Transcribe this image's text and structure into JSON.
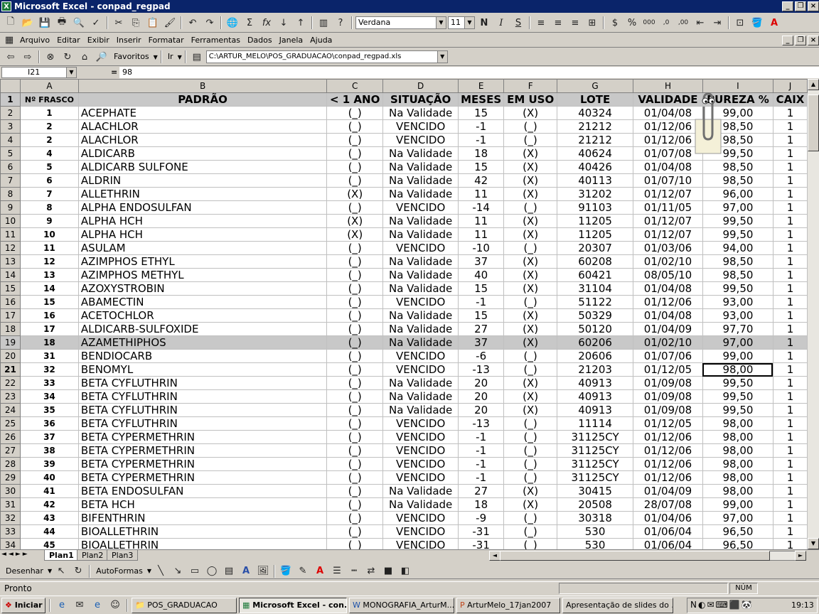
{
  "window": {
    "title": "Microsoft Excel - conpad_regpad"
  },
  "toolbar": {
    "font_name": "Verdana",
    "font_size": "11",
    "bold": "N",
    "italic": "I",
    "underline": "S"
  },
  "menu": [
    "Arquivo",
    "Editar",
    "Exibir",
    "Inserir",
    "Formatar",
    "Ferramentas",
    "Dados",
    "Janela",
    "Ajuda"
  ],
  "webbar": {
    "favorites": "Favoritos",
    "go": "Ir",
    "path": "C:\\ARTUR_MELO\\POS_GRADUACAO\\conpad_regpad.xls"
  },
  "formula_bar": {
    "name_box": "I21",
    "equals": "=",
    "value": "98"
  },
  "columns": [
    "A",
    "B",
    "C",
    "D",
    "E",
    "F",
    "G",
    "H",
    "I",
    "J"
  ],
  "headers": [
    "Nº FRASCO",
    "PADRÃO",
    "< 1 ANO",
    "SITUAÇÃO",
    "MESES",
    "EM USO",
    "LOTE",
    "VALIDADE",
    "PUREZA %",
    "CAIX"
  ],
  "rows": [
    [
      "2",
      "1",
      "ACEPHATE",
      "(_)",
      "Na Validade",
      "15",
      "(X)",
      "40324",
      "01/04/08",
      "99,00",
      "1"
    ],
    [
      "3",
      "2",
      "ALACHLOR",
      "(_)",
      "VENCIDO",
      "-1",
      "(_)",
      "21212",
      "01/12/06",
      "98,50",
      "1"
    ],
    [
      "4",
      "2",
      "ALACHLOR",
      "(_)",
      "VENCIDO",
      "-1",
      "(_)",
      "21212",
      "01/12/06",
      "98,50",
      "1"
    ],
    [
      "5",
      "4",
      "ALDICARB",
      "(_)",
      "Na Validade",
      "18",
      "(X)",
      "40624",
      "01/07/08",
      "99,50",
      "1"
    ],
    [
      "6",
      "5",
      "ALDICARB SULFONE",
      "(_)",
      "Na Validade",
      "15",
      "(X)",
      "40426",
      "01/04/08",
      "98,50",
      "1"
    ],
    [
      "7",
      "6",
      "ALDRIN",
      "(_)",
      "Na Validade",
      "42",
      "(X)",
      "40113",
      "01/07/10",
      "98,50",
      "1"
    ],
    [
      "8",
      "7",
      "ALLETHRIN",
      "(X)",
      "Na Validade",
      "11",
      "(X)",
      "31202",
      "01/12/07",
      "96,00",
      "1"
    ],
    [
      "9",
      "8",
      "ALPHA ENDOSULFAN",
      "(_)",
      "VENCIDO",
      "-14",
      "(_)",
      "91103",
      "01/11/05",
      "97,00",
      "1"
    ],
    [
      "10",
      "9",
      "ALPHA HCH",
      "(X)",
      "Na Validade",
      "11",
      "(X)",
      "11205",
      "01/12/07",
      "99,50",
      "1"
    ],
    [
      "11",
      "10",
      "ALPHA HCH",
      "(X)",
      "Na Validade",
      "11",
      "(X)",
      "11205",
      "01/12/07",
      "99,50",
      "1"
    ],
    [
      "12",
      "11",
      "ASULAM",
      "(_)",
      "VENCIDO",
      "-10",
      "(_)",
      "20307",
      "01/03/06",
      "94,00",
      "1"
    ],
    [
      "13",
      "12",
      "AZIMPHOS ETHYL",
      "(_)",
      "Na Validade",
      "37",
      "(X)",
      "60208",
      "01/02/10",
      "98,50",
      "1"
    ],
    [
      "14",
      "13",
      "AZIMPHOS METHYL",
      "(_)",
      "Na Validade",
      "40",
      "(X)",
      "60421",
      "08/05/10",
      "98,50",
      "1"
    ],
    [
      "15",
      "14",
      "AZOXYSTROBIN",
      "(_)",
      "Na Validade",
      "15",
      "(X)",
      "31104",
      "01/04/08",
      "99,50",
      "1"
    ],
    [
      "16",
      "15",
      "ABAMECTIN",
      "(_)",
      "VENCIDO",
      "-1",
      "(_)",
      "51122",
      "01/12/06",
      "93,00",
      "1"
    ],
    [
      "17",
      "16",
      "ACETOCHLOR",
      "(_)",
      "Na Validade",
      "15",
      "(X)",
      "50329",
      "01/04/08",
      "93,00",
      "1"
    ],
    [
      "18",
      "17",
      "ALDICARB-SULFOXIDE",
      "(_)",
      "Na Validade",
      "27",
      "(X)",
      "50120",
      "01/04/09",
      "97,70",
      "1"
    ],
    [
      "19",
      "18",
      "AZAMETHIPHOS",
      "(_)",
      "Na Validade",
      "37",
      "(X)",
      "60206",
      "01/02/10",
      "97,00",
      "1"
    ],
    [
      "20",
      "31",
      "BENDIOCARB",
      "(_)",
      "VENCIDO",
      "-6",
      "(_)",
      "20606",
      "01/07/06",
      "99,00",
      "1"
    ],
    [
      "21",
      "32",
      "BENOMYL",
      "(_)",
      "VENCIDO",
      "-13",
      "(_)",
      "21203",
      "01/12/05",
      "98,00",
      "1"
    ],
    [
      "22",
      "33",
      "BETA CYFLUTHRIN",
      "(_)",
      "Na Validade",
      "20",
      "(X)",
      "40913",
      "01/09/08",
      "99,50",
      "1"
    ],
    [
      "23",
      "34",
      "BETA CYFLUTHRIN",
      "(_)",
      "Na Validade",
      "20",
      "(X)",
      "40913",
      "01/09/08",
      "99,50",
      "1"
    ],
    [
      "24",
      "35",
      "BETA CYFLUTHRIN",
      "(_)",
      "Na Validade",
      "20",
      "(X)",
      "40913",
      "01/09/08",
      "99,50",
      "1"
    ],
    [
      "25",
      "36",
      "BETA CYFLUTHRIN",
      "(_)",
      "VENCIDO",
      "-13",
      "(_)",
      "11114",
      "01/12/05",
      "98,00",
      "1"
    ],
    [
      "26",
      "37",
      "BETA CYPERMETHRIN",
      "(_)",
      "VENCIDO",
      "-1",
      "(_)",
      "31125CY",
      "01/12/06",
      "98,00",
      "1"
    ],
    [
      "27",
      "38",
      "BETA CYPERMETHRIN",
      "(_)",
      "VENCIDO",
      "-1",
      "(_)",
      "31125CY",
      "01/12/06",
      "98,00",
      "1"
    ],
    [
      "28",
      "39",
      "BETA CYPERMETHRIN",
      "(_)",
      "VENCIDO",
      "-1",
      "(_)",
      "31125CY",
      "01/12/06",
      "98,00",
      "1"
    ],
    [
      "29",
      "40",
      "BETA CYPERMETHRIN",
      "(_)",
      "VENCIDO",
      "-1",
      "(_)",
      "31125CY",
      "01/12/06",
      "98,00",
      "1"
    ],
    [
      "30",
      "41",
      "BETA ENDOSULFAN",
      "(_)",
      "Na Validade",
      "27",
      "(X)",
      "30415",
      "01/04/09",
      "98,00",
      "1"
    ],
    [
      "31",
      "42",
      "BETA HCH",
      "(_)",
      "Na Validade",
      "18",
      "(X)",
      "20508",
      "28/07/08",
      "99,00",
      "1"
    ],
    [
      "32",
      "43",
      "BIFENTHRIN",
      "(_)",
      "VENCIDO",
      "-9",
      "(_)",
      "30318",
      "01/04/06",
      "97,00",
      "1"
    ],
    [
      "33",
      "44",
      "BIOALLETHRIN",
      "(_)",
      "VENCIDO",
      "-31",
      "(_)",
      "530",
      "01/06/04",
      "96,50",
      "1"
    ],
    [
      "34",
      "45",
      "BIOALLETHRIN",
      "(_)",
      "VENCIDO",
      "-31",
      "(_)",
      "530",
      "01/06/04",
      "96,50",
      "1"
    ]
  ],
  "sheet_tabs": [
    "Plan1",
    "Plan2",
    "Plan3"
  ],
  "drawing": {
    "draw": "Desenhar",
    "autoshapes": "AutoFormas"
  },
  "status": {
    "text": "Pronto",
    "num": "NÚM"
  },
  "taskbar": {
    "start": "Iniciar",
    "tasks": [
      "POS_GRADUACAO",
      "Microsoft Excel - con...",
      "MONOGRAFIA_ArturM...",
      "ArturMelo_17jan2007",
      "Apresentação de slides do ..."
    ],
    "clock": "19:13"
  }
}
